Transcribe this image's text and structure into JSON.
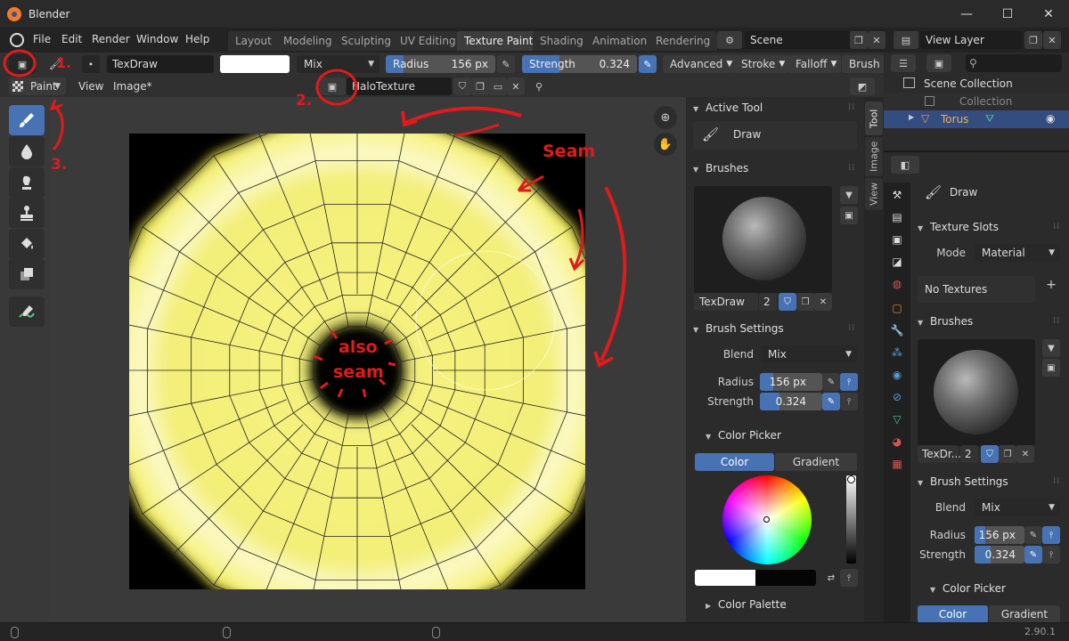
{
  "window": {
    "app_title": "Blender",
    "minimize": "—",
    "maximize": "☐",
    "close": "✕"
  },
  "menu": {
    "items": [
      "File",
      "Edit",
      "Render",
      "Window",
      "Help"
    ]
  },
  "workspaces": {
    "tabs": [
      "Layout",
      "Modeling",
      "Sculpting",
      "UV Editing",
      "Texture Paint",
      "Shading",
      "Animation",
      "Rendering"
    ],
    "active": "Texture Paint"
  },
  "scene": {
    "name": "Scene",
    "view_layer": "View Layer"
  },
  "toolheader": {
    "brush_name": "TexDraw",
    "blend_mode": "Mix",
    "radius_label": "Radius",
    "radius_value": "156 px",
    "radius_fraction": 0.16,
    "strength_label": "Strength",
    "strength_value": "0.324",
    "strength_fraction": 0.324,
    "advanced": "Advanced",
    "stroke": "Stroke",
    "falloff": "Falloff",
    "brush_tip": "Brush T"
  },
  "imgheader": {
    "mode": "Paint",
    "view": "View",
    "image_menu": "Image*",
    "image_name": "HaloTexture"
  },
  "annotations": {
    "one": "1.",
    "two": "2.",
    "three": "3.",
    "seam": "Seam",
    "also": "also",
    "seam2": "seam"
  },
  "npanel": {
    "tabs": [
      "Tool",
      "Image",
      "View"
    ],
    "active_tool_title": "Active Tool",
    "active_tool_name": "Draw",
    "brushes_title": "Brushes",
    "brush_name": "TexDraw",
    "brush_users": "2",
    "brush_settings_title": "Brush Settings",
    "blend_label": "Blend",
    "blend_value": "Mix",
    "radius_label": "Radius",
    "radius_value": "156 px",
    "strength_label": "Strength",
    "strength_value": "0.324",
    "color_picker_title": "Color Picker",
    "color_tab": "Color",
    "gradient_tab": "Gradient",
    "color_palette_title": "Color Palette"
  },
  "outliner": {
    "scene_collection": "Scene Collection",
    "collection": "Collection",
    "object": "Torus"
  },
  "props": {
    "tool_name": "Draw",
    "texture_slots_title": "Texture Slots",
    "mode_label": "Mode",
    "mode_value": "Material",
    "no_textures": "No Textures",
    "brushes_title": "Brushes",
    "brush_name": "TexDr...",
    "brush_users": "2",
    "brush_settings_title": "Brush Settings",
    "blend_label": "Blend",
    "blend_value": "Mix",
    "radius_label": "Radius",
    "radius_value": "156 px",
    "strength_label": "Strength",
    "strength_value": "0.324",
    "color_picker_title": "Color Picker",
    "color_tab": "Color",
    "gradient_tab": "Gradient"
  },
  "status": {
    "version": "2.90.1"
  },
  "colors": {
    "accent": "#4772b3",
    "annotation": "#e01b1b",
    "paint": "#f6f27e"
  }
}
